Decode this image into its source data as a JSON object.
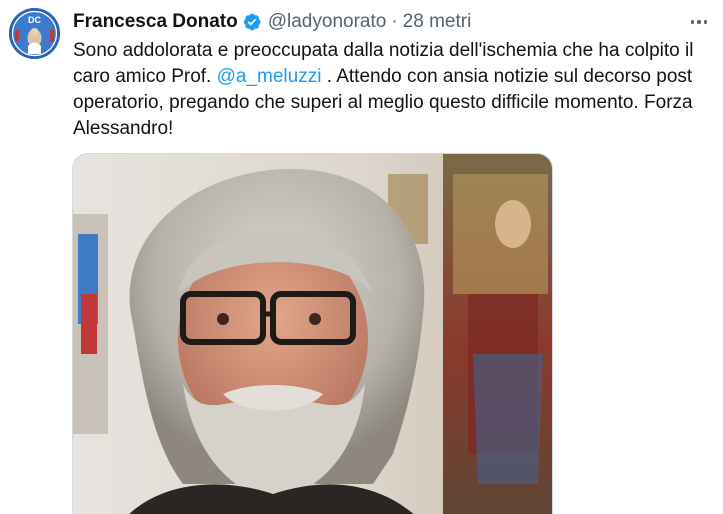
{
  "author": {
    "name": "Francesca Donato",
    "handle": "@ladyonorato",
    "separator": "·",
    "time": "28 metri",
    "avatar_logo_text": "DC"
  },
  "tweet": {
    "text_part1": "Sono addolorata e preoccupata dalla notizia dell'ischemia che ha colpito il caro amico Prof. ",
    "mention": "@a_meluzzi",
    "text_part2": " . Attendo con ansia notizie sul decorso post operatorio, pregando che superi al meglio questo difficile momento. Forza Alessandro!"
  },
  "icons": {
    "verified": "verified-badge-icon",
    "more": "more-options-icon"
  },
  "colors": {
    "accent": "#1d9bf0",
    "secondary_text": "#536471",
    "primary_text": "#0f1419",
    "border": "#cfd9de"
  }
}
